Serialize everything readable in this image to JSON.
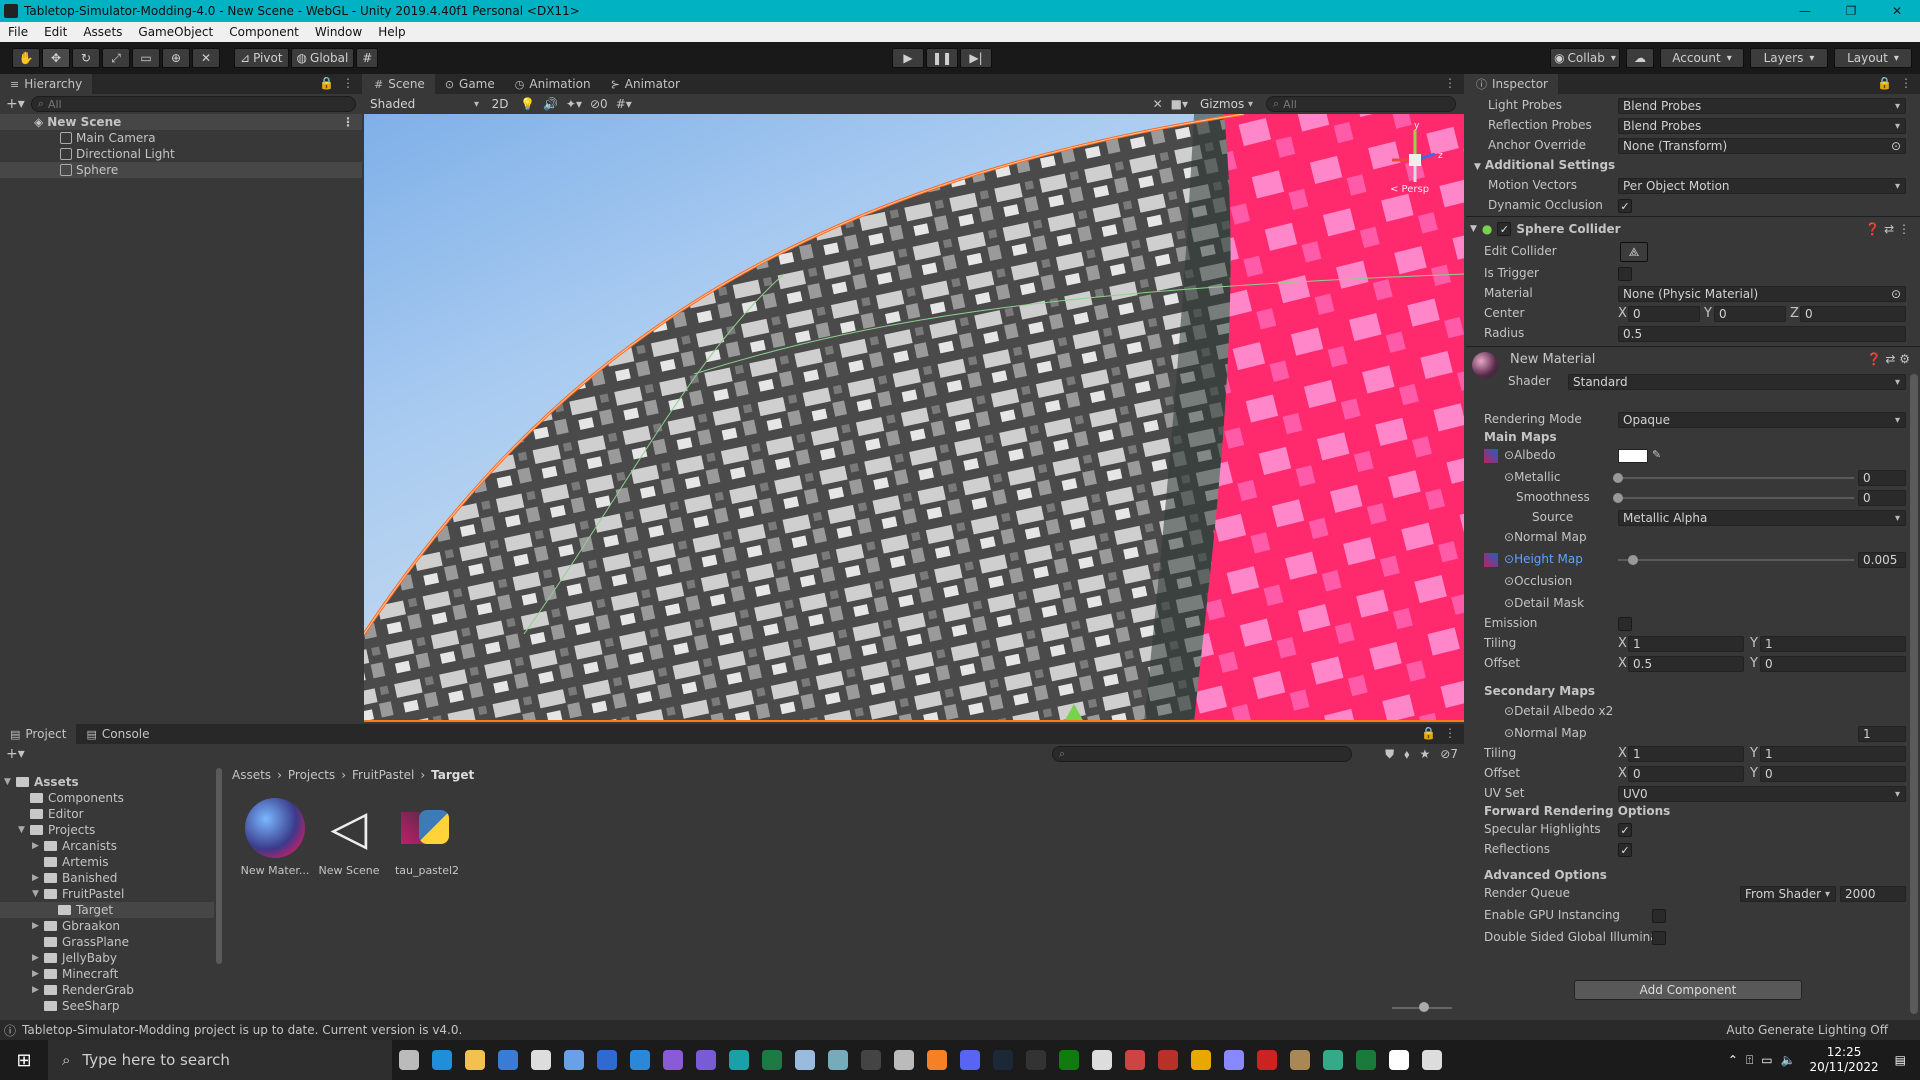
{
  "window": {
    "title": "Tabletop-Simulator-Modding-4.0 - New Scene - WebGL - Unity 2019.4.40f1 Personal <DX11>"
  },
  "menu": [
    "File",
    "Edit",
    "Assets",
    "GameObject",
    "Component",
    "Window",
    "Help"
  ],
  "toolbar": {
    "pivot": "Pivot",
    "global": "Global",
    "collab": "Collab",
    "account": "Account",
    "layers": "Layers",
    "layout": "Layout"
  },
  "hierarchy": {
    "tab": "Hierarchy",
    "search_placeholder": "All",
    "scene": "New Scene",
    "items": [
      "Main Camera",
      "Directional Light",
      "Sphere"
    ]
  },
  "scene_view": {
    "tabs": [
      "Scene",
      "Game",
      "Animation",
      "Animator"
    ],
    "shading": "Shaded",
    "mode2d": "2D",
    "hidden_count": "0",
    "gizmos": "Gizmos",
    "search_placeholder": "All",
    "persp": "< Persp",
    "gizmo_axes": {
      "y": "y",
      "z": "z"
    }
  },
  "inspector": {
    "tab": "Inspector",
    "rows": [
      {
        "label": "Light Probes",
        "value": "Blend Probes",
        "kind": "dd"
      },
      {
        "label": "Reflection Probes",
        "value": "Blend Probes",
        "kind": "dd"
      },
      {
        "label": "Anchor Override",
        "value": "None (Transform)",
        "kind": "obj"
      }
    ],
    "additional_settings": "Additional Settings",
    "motion_vectors": {
      "label": "Motion Vectors",
      "value": "Per Object Motion"
    },
    "dynamic_occlusion": {
      "label": "Dynamic Occlusion",
      "checked": true
    },
    "collider": {
      "title": "Sphere Collider",
      "edit_collider": "Edit Collider",
      "is_trigger": "Is Trigger",
      "material_label": "Material",
      "material_value": "None (Physic Material)",
      "center_label": "Center",
      "cx": "X",
      "cx_val": "0",
      "cy": "Y",
      "cy_val": "0",
      "cz": "Z",
      "cz_val": "0",
      "radius_label": "Radius",
      "radius_val": "0.5"
    },
    "material": {
      "name": "New Material",
      "shader_label": "Shader",
      "shader": "Standard",
      "rendering_mode_label": "Rendering Mode",
      "rendering_mode": "Opaque",
      "main_maps": "Main Maps",
      "albedo": "Albedo",
      "metallic": "Metallic",
      "metallic_val": "0",
      "metallic_level": 0,
      "smoothness": "Smoothness",
      "smoothness_val": "0",
      "smoothness_level": 0,
      "source_label": "Source",
      "source": "Metallic Alpha",
      "normal_map": "Normal Map",
      "height_map": "Height Map",
      "height_val": "0.005",
      "height_level": 0.005,
      "occlusion": "Occlusion",
      "detail_mask": "Detail Mask",
      "emission": "Emission",
      "tiling_label": "Tiling",
      "tx": "X",
      "tx_val": "1",
      "ty": "Y",
      "ty_val": "1",
      "offset_label": "Offset",
      "ox": "X",
      "ox_val": "0.5",
      "oy": "Y",
      "oy_val": "0",
      "secondary_maps": "Secondary Maps",
      "detail_albedo": "Detail Albedo x2",
      "normal_map2": "Normal Map",
      "normal_map2_val": "1",
      "tiling2_label": "Tiling",
      "t2x": "X",
      "t2x_val": "1",
      "t2y": "Y",
      "t2y_val": "1",
      "offset2_label": "Offset",
      "o2x": "X",
      "o2x_val": "0",
      "o2y": "Y",
      "o2y_val": "0",
      "uv_set_label": "UV Set",
      "uv_set": "UV0",
      "forward_options": "Forward Rendering Options",
      "specular_highlights": "Specular Highlights",
      "reflections": "Reflections",
      "advanced_options": "Advanced Options",
      "render_queue_label": "Render Queue",
      "render_queue_mode": "From Shader",
      "render_queue_val": "2000",
      "gpu_instancing": "Enable GPU Instancing",
      "double_sided": "Double Sided Global Illuminat"
    },
    "add_component": "Add Component"
  },
  "project": {
    "tabs": [
      "Project",
      "Console"
    ],
    "hidden_count": "7",
    "breadcrumb": [
      "Assets",
      "Projects",
      "FruitPastel",
      "Target"
    ],
    "tree": [
      {
        "label": "Assets",
        "depth": 0,
        "arrow": "open",
        "bold": true
      },
      {
        "label": "Components",
        "depth": 1,
        "arrow": ""
      },
      {
        "label": "Editor",
        "depth": 1,
        "arrow": ""
      },
      {
        "label": "Projects",
        "depth": 1,
        "arrow": "open"
      },
      {
        "label": "Arcanists",
        "depth": 2,
        "arrow": "closed"
      },
      {
        "label": "Artemis",
        "depth": 2,
        "arrow": ""
      },
      {
        "label": "Banished",
        "depth": 2,
        "arrow": "closed"
      },
      {
        "label": "FruitPastel",
        "depth": 2,
        "arrow": "open"
      },
      {
        "label": "Target",
        "depth": 3,
        "arrow": "",
        "selected": true
      },
      {
        "label": "Gbraakon",
        "depth": 2,
        "arrow": "closed"
      },
      {
        "label": "GrassPlane",
        "depth": 2,
        "arrow": ""
      },
      {
        "label": "JellyBaby",
        "depth": 2,
        "arrow": "closed"
      },
      {
        "label": "Minecraft",
        "depth": 2,
        "arrow": "closed"
      },
      {
        "label": "RenderGrab",
        "depth": 2,
        "arrow": "closed"
      },
      {
        "label": "SeeSharp",
        "depth": 2,
        "arrow": ""
      }
    ],
    "assets": [
      "New Mater...",
      "New Scene",
      "tau_pastel2"
    ]
  },
  "status": {
    "message": "Tabletop-Simulator-Modding project is up to date. Current version is v4.0.",
    "lighting": "Auto Generate Lighting Off"
  },
  "taskbar": {
    "search_placeholder": "Type here to search",
    "time": "12:25",
    "date": "20/11/2022"
  },
  "colors": {
    "title_bar": "#00b2c2",
    "panel": "#383838",
    "tab_bar": "#282828",
    "toolbar": "#191919",
    "pink": "#ff2a6d",
    "link_blue": "#5ea3ff"
  }
}
